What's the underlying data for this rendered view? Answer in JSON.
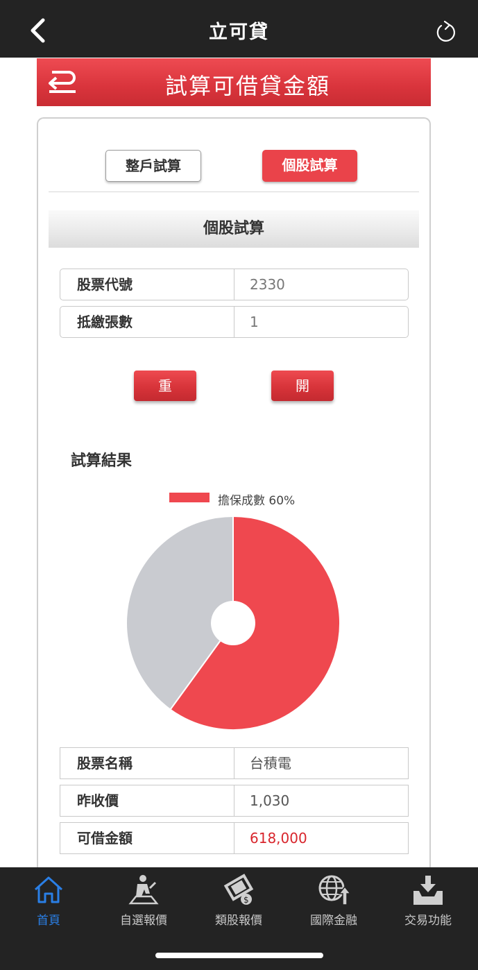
{
  "nav": {
    "title": "立可貸"
  },
  "banner": {
    "title": "試算可借貸金額"
  },
  "segments": {
    "whole_account": "整戶試算",
    "single_stock": "個股試算"
  },
  "section": {
    "title": "個股試算"
  },
  "form": {
    "stock_code_label": "股票代號",
    "stock_code_value": "2330",
    "pledge_qty_label": "抵繳張數",
    "pledge_qty_value": "1",
    "reset_label": "重",
    "open_label": "開"
  },
  "result": {
    "title": "試算結果",
    "stock_name_label": "股票名稱",
    "stock_name_value": "台積電",
    "prev_close_label": "昨收價",
    "prev_close_value": "1,030",
    "loanable_label": "可借金額",
    "loanable_value": "618,000"
  },
  "chart_data": {
    "type": "pie",
    "categories": [
      "擔保成數 60%",
      ""
    ],
    "values": [
      60,
      40
    ],
    "colors": [
      "#ef484f",
      "#c9cbd0"
    ],
    "legend": [
      "擔保成數 60%"
    ],
    "legend_placement": "top",
    "donut_hole": true
  },
  "tabbar": {
    "items": [
      {
        "label": "首頁",
        "icon": "home-icon",
        "active": true
      },
      {
        "label": "自選報價",
        "icon": "watchlist-icon",
        "active": false
      },
      {
        "label": "類股報價",
        "icon": "sector-film-icon",
        "active": false
      },
      {
        "label": "國際金融",
        "icon": "globe-icon",
        "active": false
      },
      {
        "label": "交易功能",
        "icon": "download-tray-icon",
        "active": false
      }
    ],
    "active_color": "#2a7fe6"
  },
  "colors": {
    "accent": "#ea434a",
    "dark_bar": "#232323"
  }
}
